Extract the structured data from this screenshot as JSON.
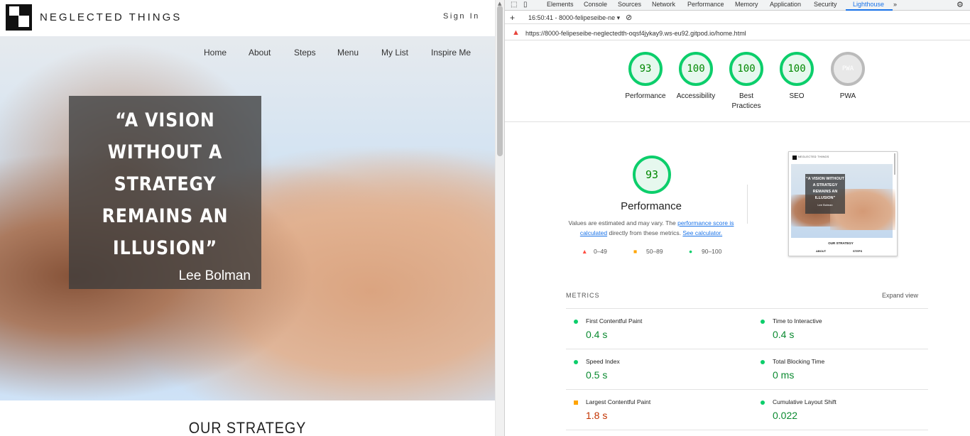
{
  "site": {
    "brand": "NEGLECTED THINGS",
    "signin": "Sign In",
    "nav": [
      "Home",
      "About",
      "Steps",
      "Menu",
      "My List",
      "Inspire Me"
    ],
    "quote_lines": [
      "“A VISION",
      "WITHOUT A",
      "STRATEGY",
      "REMAINS AN",
      "ILLUSION”"
    ],
    "quote_author": "Lee Bolman",
    "section_heading": "OUR STRATEGY"
  },
  "devtools": {
    "tabs": [
      "Elements",
      "Console",
      "Sources",
      "Network",
      "Performance",
      "Memory",
      "Application",
      "Security",
      "Lighthouse"
    ],
    "active_tab": "Lighthouse",
    "more": "»",
    "report_select": "16:50:41 - 8000-felipeseibe-ne ▾",
    "url": "https://8000-felipeseibe-neglectedth-oqsf4jykay9.ws-eu92.gitpod.io/home.html",
    "scores": [
      {
        "label": "Performance",
        "value": "93"
      },
      {
        "label": "Accessibility",
        "value": "100"
      },
      {
        "label": "Best Practices",
        "value": "100"
      },
      {
        "label": "SEO",
        "value": "100"
      },
      {
        "label": "PWA",
        "value": "PWA"
      }
    ],
    "perf": {
      "score": "93",
      "title": "Performance",
      "desc_1": "Values are estimated and may vary. The ",
      "desc_link1": "performance score is calculated",
      "desc_2": " directly from these metrics. ",
      "desc_link2": "See calculator.",
      "legend": [
        "0–49",
        "50–89",
        "90–100"
      ]
    },
    "thumbnail": {
      "brand": "NEGLECTED THINGS",
      "quote": "“A VISION WITHOUT A STRATEGY REMAINS AN ILLUSION”",
      "author": "Lee Bolman",
      "heading": "OUR STRATEGY",
      "about": "ABOUT",
      "steps": "STEPS"
    },
    "metrics_heading": "METRICS",
    "expand_view": "Expand view",
    "metrics": [
      {
        "name": "First Contentful Paint",
        "value": "0.4 s",
        "status": "pass"
      },
      {
        "name": "Time to Interactive",
        "value": "0.4 s",
        "status": "pass"
      },
      {
        "name": "Speed Index",
        "value": "0.5 s",
        "status": "pass"
      },
      {
        "name": "Total Blocking Time",
        "value": "0 ms",
        "status": "pass"
      },
      {
        "name": "Largest Contentful Paint",
        "value": "1.8 s",
        "status": "average"
      },
      {
        "name": "Cumulative Layout Shift",
        "value": "0.022",
        "status": "pass"
      }
    ],
    "colors": {
      "pass": "#0cce6b",
      "average": "#ffa400",
      "fail": "#ff4e42",
      "accent": "#1a73e8"
    }
  }
}
